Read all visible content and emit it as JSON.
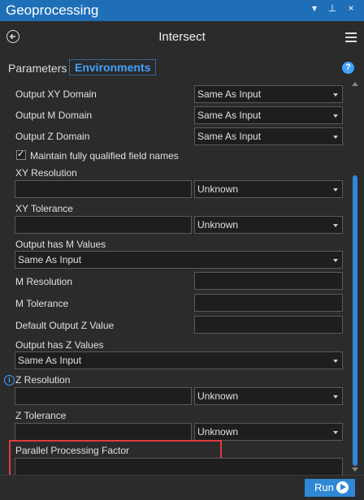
{
  "window": {
    "title": "Geoprocessing",
    "controls": [
      "▾",
      "⊥",
      "×"
    ]
  },
  "tool": {
    "title": "Intersect"
  },
  "tabs": {
    "parameters": "Parameters",
    "environments": "Environments"
  },
  "help_icon": "?",
  "fields": {
    "output_xy_domain": {
      "label": "Output XY Domain",
      "value": "Same As Input"
    },
    "output_m_domain": {
      "label": "Output M Domain",
      "value": "Same As Input"
    },
    "output_z_domain": {
      "label": "Output Z Domain",
      "value": "Same As Input"
    },
    "maintain_qualified": {
      "label": "Maintain fully qualified field names",
      "checked": true,
      "mark": "✓"
    },
    "xy_resolution": {
      "label": "XY Resolution",
      "value": "",
      "unit": "Unknown"
    },
    "xy_tolerance": {
      "label": "XY Tolerance",
      "value": "",
      "unit": "Unknown"
    },
    "output_has_m": {
      "label": "Output has M Values",
      "value": "Same As Input"
    },
    "m_resolution": {
      "label": "M Resolution",
      "value": ""
    },
    "m_tolerance": {
      "label": "M Tolerance",
      "value": ""
    },
    "default_output_z": {
      "label": "Default Output Z Value",
      "value": ""
    },
    "output_has_z": {
      "label": "Output has Z Values",
      "value": "Same As Input"
    },
    "z_resolution": {
      "label": "Z Resolution",
      "value": "",
      "unit": "Unknown",
      "info_icon": "i"
    },
    "z_tolerance": {
      "label": "Z Tolerance",
      "value": "",
      "unit": "Unknown"
    },
    "parallel_processing": {
      "label": "Parallel Processing Factor",
      "value": ""
    }
  },
  "footer": {
    "run_label": "Run"
  },
  "colors": {
    "accent": "#2f87d6",
    "highlight": "#e23b3b",
    "title_bar": "#1f6fb8"
  }
}
